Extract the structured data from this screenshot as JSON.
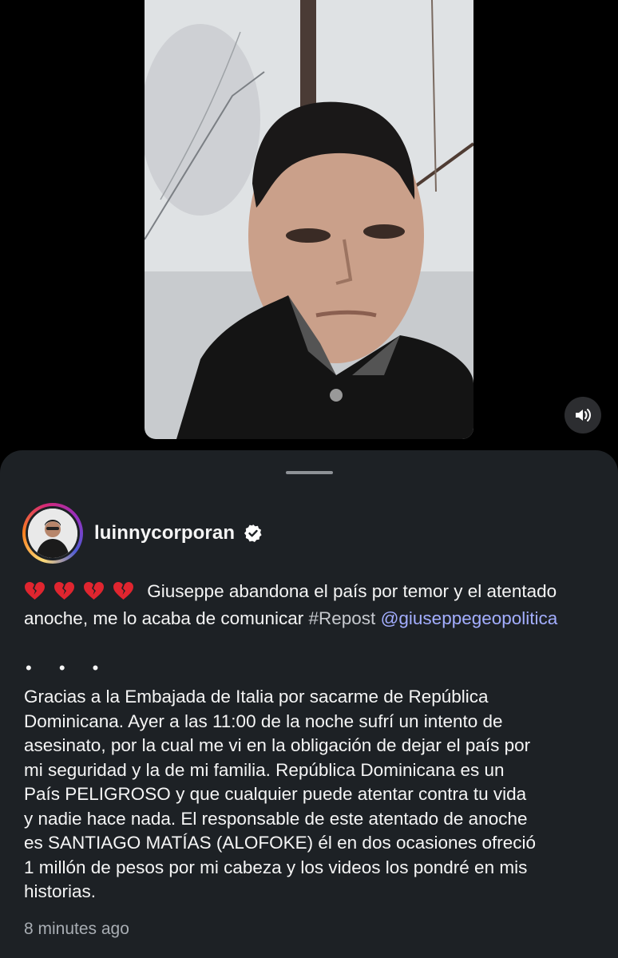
{
  "post": {
    "username": "luinnycorporan",
    "verified": true,
    "emojis": [
      "broken-heart",
      "broken-heart",
      "broken-heart",
      "broken-heart"
    ],
    "caption_text": "Giuseppe abandona el país por temor y el atentado anoche, me lo acaba de comunicar",
    "hashtag": "#Repost",
    "mention": "@giuseppegeopolitica",
    "more_dots": "• • •",
    "body_lines": [
      "Gracias a la Embajada de Italia por sacarme de República",
      "Dominicana. Ayer a las 11:00 de la noche sufrí un intento de",
      "asesinato, por la cual me vi en la obligación de dejar el país por",
      "mi seguridad y la de mi familia. República Dominicana es un",
      "País PELIGROSO y que cualquier puede atentar contra tu vida",
      "y nadie hace nada. El responsable de este atentado de anoche",
      "es SANTIAGO MATÍAS (ALOFOKE) él en dos ocasiones ofreció",
      "1 millón de pesos por mi cabeza y los videos los pondré en mis",
      "historias."
    ],
    "timestamp": "8 minutes ago"
  },
  "icons": {
    "audio": "speaker-icon",
    "verified": "verified-badge-icon",
    "emoji": "broken-heart-icon"
  },
  "colors": {
    "sheet_bg": "#1d2125",
    "mention": "#a3aeff",
    "timestamp": "#a8adb3",
    "verified": "#ffffff"
  }
}
